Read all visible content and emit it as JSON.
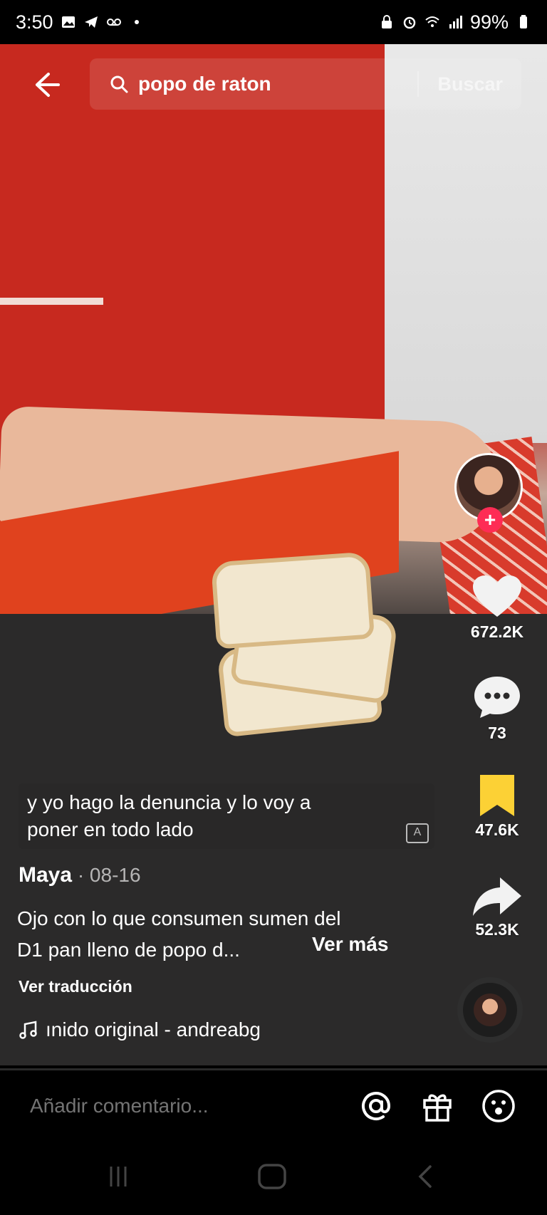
{
  "status_bar": {
    "time": "3:50",
    "battery": "99%",
    "left_icons": [
      "gallery-icon",
      "telegram-icon",
      "voicemail-icon",
      "dot-icon"
    ],
    "right_icons": [
      "lock-icon",
      "alarm-icon",
      "wifi-icon",
      "signal-icon",
      "battery-icon"
    ]
  },
  "topbar": {
    "search_query": "popo de raton",
    "search_button": "Buscar"
  },
  "rail": {
    "likes": "672.2K",
    "comments": "73",
    "saves": "47.6K",
    "shares": "52.3K",
    "follow_symbol": "+",
    "colors": {
      "follow": "#fe2c55",
      "save": "#fcd135"
    }
  },
  "caption": {
    "line1": "y yo hago la denuncia y lo voy a",
    "line2": "poner en todo lado",
    "translate_badge": "A"
  },
  "post": {
    "author": "Maya",
    "date": " · 08-16",
    "description_line1": "Ojo con lo que consumen sumen del",
    "description_line2": "D1 pan lleno de popo d...",
    "see_more": "Ver más",
    "translate": "Ver traducción",
    "music": "ınido original - andreabg"
  },
  "comment_bar": {
    "placeholder": "Añadir comentario..."
  }
}
